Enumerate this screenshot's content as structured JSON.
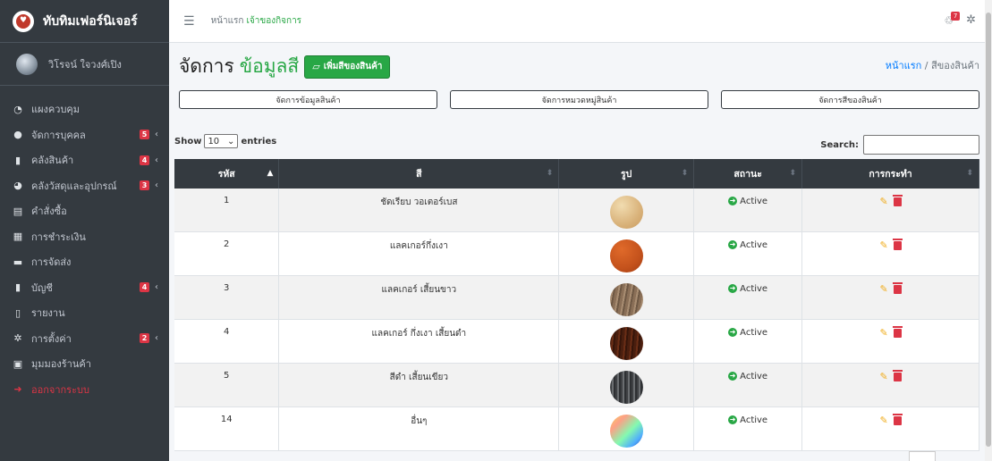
{
  "brand": {
    "name": "ทับทิมเฟอร์นิเจอร์"
  },
  "user": {
    "name": "วิโรจน์ ใจวงศ์เปิง"
  },
  "sidebar": {
    "items": [
      {
        "label": "แผงควบคุม",
        "icon": "dashboard-icon",
        "badge": "",
        "chevron": ""
      },
      {
        "label": "จัดการบุคคล",
        "icon": "user-circle-icon",
        "badge": "5",
        "chevron": "‹"
      },
      {
        "label": "คลังสินค้า",
        "icon": "copy-icon",
        "badge": "4",
        "chevron": "‹"
      },
      {
        "label": "คลังวัสดุและอุปกรณ์",
        "icon": "pie-chart-icon",
        "badge": "3",
        "chevron": "‹"
      },
      {
        "label": "คำสั่งซื้อ",
        "icon": "list-icon",
        "badge": "",
        "chevron": ""
      },
      {
        "label": "การชำระเงิน",
        "icon": "cash-register-icon",
        "badge": "",
        "chevron": ""
      },
      {
        "label": "การจัดส่ง",
        "icon": "truck-icon",
        "badge": "",
        "chevron": ""
      },
      {
        "label": "บัญชี",
        "icon": "copy-icon",
        "badge": "4",
        "chevron": "‹"
      },
      {
        "label": "รายงาน",
        "icon": "file-icon",
        "badge": "",
        "chevron": ""
      },
      {
        "label": "การตั้งค่า",
        "icon": "cogs-icon",
        "badge": "2",
        "chevron": "‹"
      },
      {
        "label": "มุมมองร้านค้า",
        "icon": "store-icon",
        "badge": "",
        "chevron": ""
      },
      {
        "label": "ออกจากระบบ",
        "icon": "sign-out-icon",
        "badge": "",
        "chevron": ""
      }
    ]
  },
  "topbar": {
    "crumb_home": "หน้าแรก",
    "crumb_active": "เจ้าของกิจการ",
    "notif_count": "7"
  },
  "header": {
    "title_prefix": "จัดการ",
    "title_highlight": "ข้อมูลสี",
    "add_button": "เพิ่มสีของสินค้า",
    "crumb_home": "หน้าแรก",
    "crumb_sep": "/",
    "crumb_current": "สีของสินค้า"
  },
  "subnav": [
    "จัดการข้อมูลสินค้า",
    "จัดการหมวดหมู่สินค้า",
    "จัดการสีของสินค้า"
  ],
  "table_controls": {
    "show": "Show",
    "entries_value": "10",
    "entries": "entries",
    "search": "Search:"
  },
  "table": {
    "headers": [
      "รหัส",
      "สี",
      "รูป",
      "สถานะ",
      "การกระทำ"
    ],
    "rows": [
      {
        "id": "1",
        "color": "ชัดเรียบ วอเตอร์เบส",
        "status": "Active",
        "swatch": "#e8c896"
      },
      {
        "id": "2",
        "color": "แลคเกอร์กึ่งเงา",
        "status": "Active",
        "swatch": "#c4521c"
      },
      {
        "id": "3",
        "color": "แลคเกอร์ เสี้ยนขาว",
        "status": "Active",
        "swatch": "#8a6f57"
      },
      {
        "id": "4",
        "color": "แลคเกอร์ กึ่งเงา เสี้ยนดำ",
        "status": "Active",
        "swatch": "#4a1f0f"
      },
      {
        "id": "5",
        "color": "สีดำ เสี้ยนเขียว",
        "status": "Active",
        "swatch": "#4d4f52"
      },
      {
        "id": "14",
        "color": "อื่นๆ",
        "status": "Active",
        "swatch": "gradient"
      }
    ]
  },
  "colors": {
    "sidebar": "#343a40",
    "accent": "#28a745",
    "danger": "#dc3545"
  }
}
